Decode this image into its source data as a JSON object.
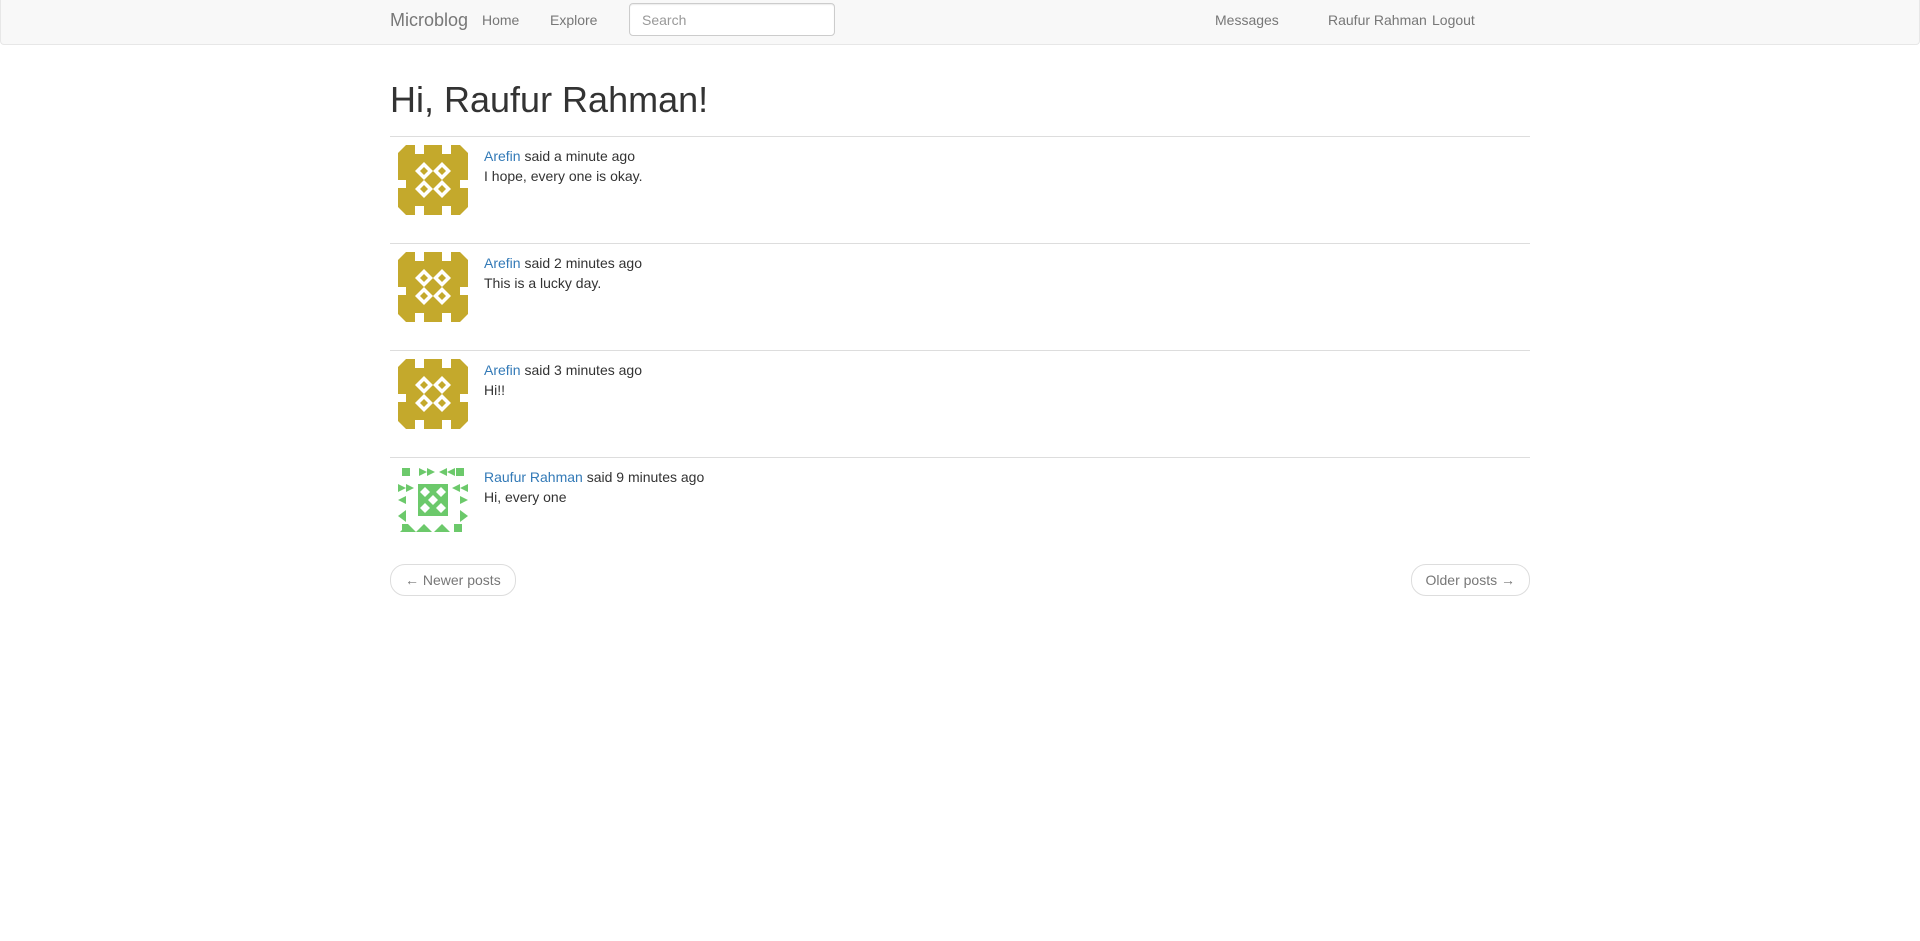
{
  "navbar": {
    "brand": "Microblog",
    "home": "Home",
    "explore": "Explore",
    "search_placeholder": "Search",
    "messages": "Messages",
    "user": "Raufur Rahman",
    "logout": "Logout"
  },
  "page_title": "Hi, Raufur Rahman!",
  "posts": [
    {
      "author": "Arefin",
      "said": "said a minute ago",
      "body": "I hope, every one is okay."
    },
    {
      "author": "Arefin",
      "said": "said 2 minutes ago",
      "body": "This is a lucky day."
    },
    {
      "author": "Arefin",
      "said": "said 3 minutes ago",
      "body": "Hi!!"
    },
    {
      "author": "Raufur Rahman",
      "said": "said 9 minutes ago",
      "body": "Hi, every one"
    }
  ],
  "pager": {
    "newer": "← Newer posts",
    "older": "Older posts →"
  },
  "colors": {
    "avatar_arefin": "#c4a92c",
    "avatar_raufur": "#6cc96b",
    "link": "#337ab7"
  }
}
